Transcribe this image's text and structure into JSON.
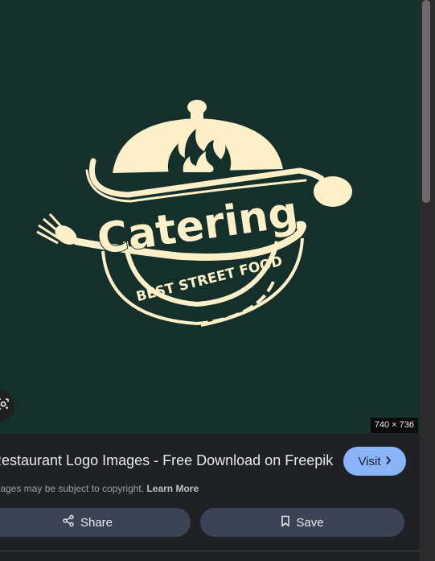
{
  "image": {
    "logo_main_text": "Catering",
    "logo_sub_text": "BEST STREET FOOD",
    "dimensions": "740 × 736",
    "colors": {
      "background": "#15302b",
      "logo": "#fdf0c8"
    }
  },
  "result": {
    "title": "Restaurant Logo Images - Free Download on Freepik",
    "visit_label": "Visit",
    "copyright_text": "Images may be subject to copyright.",
    "learn_more": "Learn More",
    "share_label": "Share",
    "save_label": "Save"
  },
  "icons": {
    "lens": "google-lens-icon",
    "chevron": "chevron-right-icon",
    "share": "share-icon",
    "save": "bookmark-icon"
  }
}
